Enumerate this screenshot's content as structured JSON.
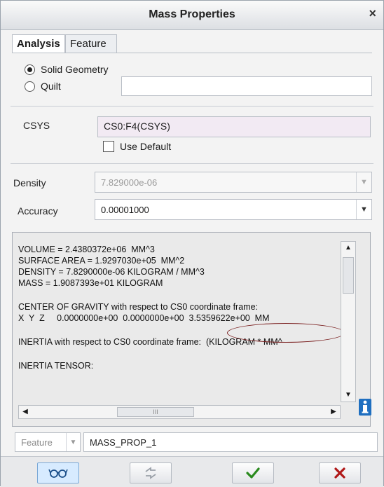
{
  "window": {
    "title": "Mass Properties",
    "close": "×"
  },
  "tabs": [
    {
      "label": "Analysis",
      "active": true
    },
    {
      "label": "Feature",
      "active": false
    }
  ],
  "geometry": {
    "options": [
      {
        "label": "Solid Geometry",
        "checked": true
      },
      {
        "label": "Quilt",
        "checked": false
      }
    ],
    "quilt_value": ""
  },
  "csys": {
    "label": "CSYS",
    "value": "CS0:F4(CSYS)",
    "use_default_label": "Use Default",
    "use_default_checked": false
  },
  "density": {
    "label": "Density",
    "value": "7.829000e-06",
    "enabled": false
  },
  "accuracy": {
    "label": "Accuracy",
    "value": "0.00001000"
  },
  "results": {
    "lines": [
      "VOLUME = 2.4380372e+06  MM^3",
      "SURFACE AREA = 1.9297030e+05  MM^2",
      "DENSITY = 7.8290000e-06 KILOGRAM / MM^3",
      "MASS = 1.9087393e+01 KILOGRAM",
      "",
      "CENTER OF GRAVITY with respect to CS0 coordinate frame:",
      "X  Y  Z     0.0000000e+00  0.0000000e+00  3.5359622e+00  MM",
      "",
      "INERTIA with respect to CS0 coordinate frame:  (KILOGRAM * MM^",
      "",
      "INERTIA TENSOR:"
    ],
    "hscroll_thumb": "III"
  },
  "feature": {
    "type_label": "Feature",
    "name": "MASS_PROP_1"
  },
  "buttons": [
    {
      "name": "preview-button",
      "icon": "glasses-icon"
    },
    {
      "name": "repaint-button",
      "icon": "repaint-arrows-icon"
    },
    {
      "name": "ok-button",
      "icon": "checkmark-icon"
    },
    {
      "name": "cancel-button",
      "icon": "x-icon"
    }
  ],
  "colors": {
    "accent": "#1f6fc0",
    "ok": "#2a8a1e",
    "cancel": "#b01818",
    "csys_bg": "#f2eaf3"
  }
}
